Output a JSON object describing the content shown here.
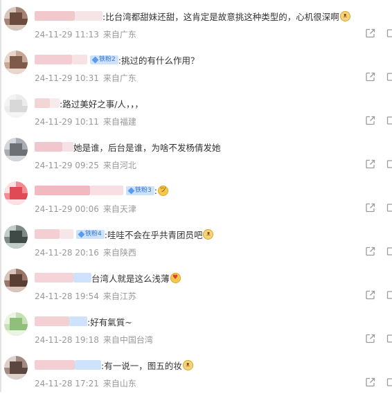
{
  "comments": [
    {
      "name_colors": [
        "#f1c9cc",
        "#f5e5e7"
      ],
      "badge": "",
      "text": ":比台湾都甜妹还甜，这肯定是故意挑这种类型的，心机很深啊",
      "emoji": "cat-icon",
      "time": "24-11-29 11:13",
      "location": "来自广东",
      "avatar_colors": [
        "#6b4b3d",
        "#a48474",
        "#d9c6bb"
      ]
    },
    {
      "name_colors": [
        "#f4cdd4",
        "#f7e3e6"
      ],
      "badge": "铁粉2",
      "text": ":挑过的有什么作用？",
      "emoji": "",
      "time": "24-11-29 10:31",
      "location": "来自广东",
      "avatar_colors": [
        "#7d5a4a",
        "#c9a795",
        "#e8d6cb"
      ]
    },
    {
      "name_colors": [
        "#f2d6d6",
        "#f7eaea"
      ],
      "badge": "",
      "text": ":路过美好之事/人，，，",
      "emoji": "",
      "time": "24-11-29 10:11",
      "location": "来自福建",
      "avatar_colors": [
        "#d8d8d8",
        "#ececec",
        "#f4f4f4"
      ]
    },
    {
      "name_colors": [
        "#f0c7cc",
        "#f6e1e4"
      ],
      "badge": "",
      "text": "她是谁，后台是谁，为啥不发杨倩发她",
      "emoji": "",
      "time": "24-11-29 09:25",
      "location": "来自河北",
      "avatar_colors": [
        "#6d7075",
        "#a9adb3",
        "#d3d6da"
      ]
    },
    {
      "name_colors": [
        "#f2b9c0",
        "#f7dfe3"
      ],
      "badge": "铁粉3",
      "text": ":",
      "emoji": "laugh-cry-icon",
      "time": "24-11-29 00:06",
      "location": "来自天津",
      "avatar_colors": [
        "#e04a55",
        "#f48a92",
        "#fde0e3"
      ]
    },
    {
      "name_colors": [
        "#f3cfd3",
        "#f7e6e8"
      ],
      "badge": "铁粉4",
      "text": ":哇哇不会在乎共青团员吧",
      "emoji": "cat-icon",
      "time": "24-11-28 20:16",
      "location": "来自陕西",
      "avatar_colors": [
        "#3f4a46",
        "#7d8a86",
        "#c4ccc9"
      ]
    },
    {
      "name_colors": [
        "#f4d4d8",
        "#cfe2fb"
      ],
      "badge": "",
      "text": "台湾人就是这么浅薄",
      "emoji": "heart-eyes-icon",
      "time": "24-11-28 19:54",
      "location": "来自江苏",
      "avatar_colors": [
        "#5a3e34",
        "#9a7668",
        "#d8c4ba"
      ]
    },
    {
      "name_colors": [
        "#f2d0d4",
        "#cfe2fb"
      ],
      "badge": "",
      "text": ":好有氣質~",
      "emoji": "",
      "time": "24-11-28 19:18",
      "location": "来自中国台湾",
      "avatar_colors": [
        "#8fbf7a",
        "#c7e0b6",
        "#eaf4e2"
      ]
    },
    {
      "name_colors": [
        "#f3ced2",
        "#cfe2fb"
      ],
      "badge": "",
      "text": ":有一说一，图五的妆",
      "emoji": "cat-icon",
      "time": "24-11-28 17:21",
      "location": "来自山东",
      "avatar_colors": [
        "#5b4640",
        "#a38b84",
        "#ddd0cb"
      ]
    }
  ]
}
